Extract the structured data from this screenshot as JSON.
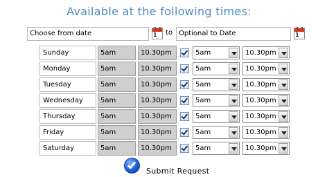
{
  "title": "Available at the following times:",
  "date_range": {
    "from_value": "Choose from date",
    "to_label": "to",
    "to_value": "Optional to Date",
    "calendar_icon": "calendar-icon"
  },
  "schedule": [
    {
      "day": "Sunday",
      "start": "5am",
      "end": "10.30pm",
      "checked": true,
      "sel_start": "5am",
      "sel_end": "10.30pm"
    },
    {
      "day": "Monday",
      "start": "5am",
      "end": "10.30pm",
      "checked": true,
      "sel_start": "5am",
      "sel_end": "10.30pm"
    },
    {
      "day": "Tuesday",
      "start": "5am",
      "end": "10.30pm",
      "checked": true,
      "sel_start": "5am",
      "sel_end": "10.30pm"
    },
    {
      "day": "Wednesday",
      "start": "5am",
      "end": "10.30pm",
      "checked": true,
      "sel_start": "5am",
      "sel_end": "10.30pm"
    },
    {
      "day": "Thursday",
      "start": "5am",
      "end": "10.30pm",
      "checked": true,
      "sel_start": "5am",
      "sel_end": "10.30pm"
    },
    {
      "day": "Friday",
      "start": "5am",
      "end": "10.30pm",
      "checked": true,
      "sel_start": "5am",
      "sel_end": "10.30pm"
    },
    {
      "day": "Saturday",
      "start": "5am",
      "end": "10.30pm",
      "checked": true,
      "sel_start": "5am",
      "sel_end": "10.30pm"
    }
  ],
  "submit": {
    "label": "Submit Request",
    "icon": "checkmark-circle-icon"
  },
  "colors": {
    "title": "#4a8ac4",
    "readonly_bg": "#cfcfcf",
    "calendar_red": "#e2371f",
    "submit_blue": "#1d5fd8"
  }
}
